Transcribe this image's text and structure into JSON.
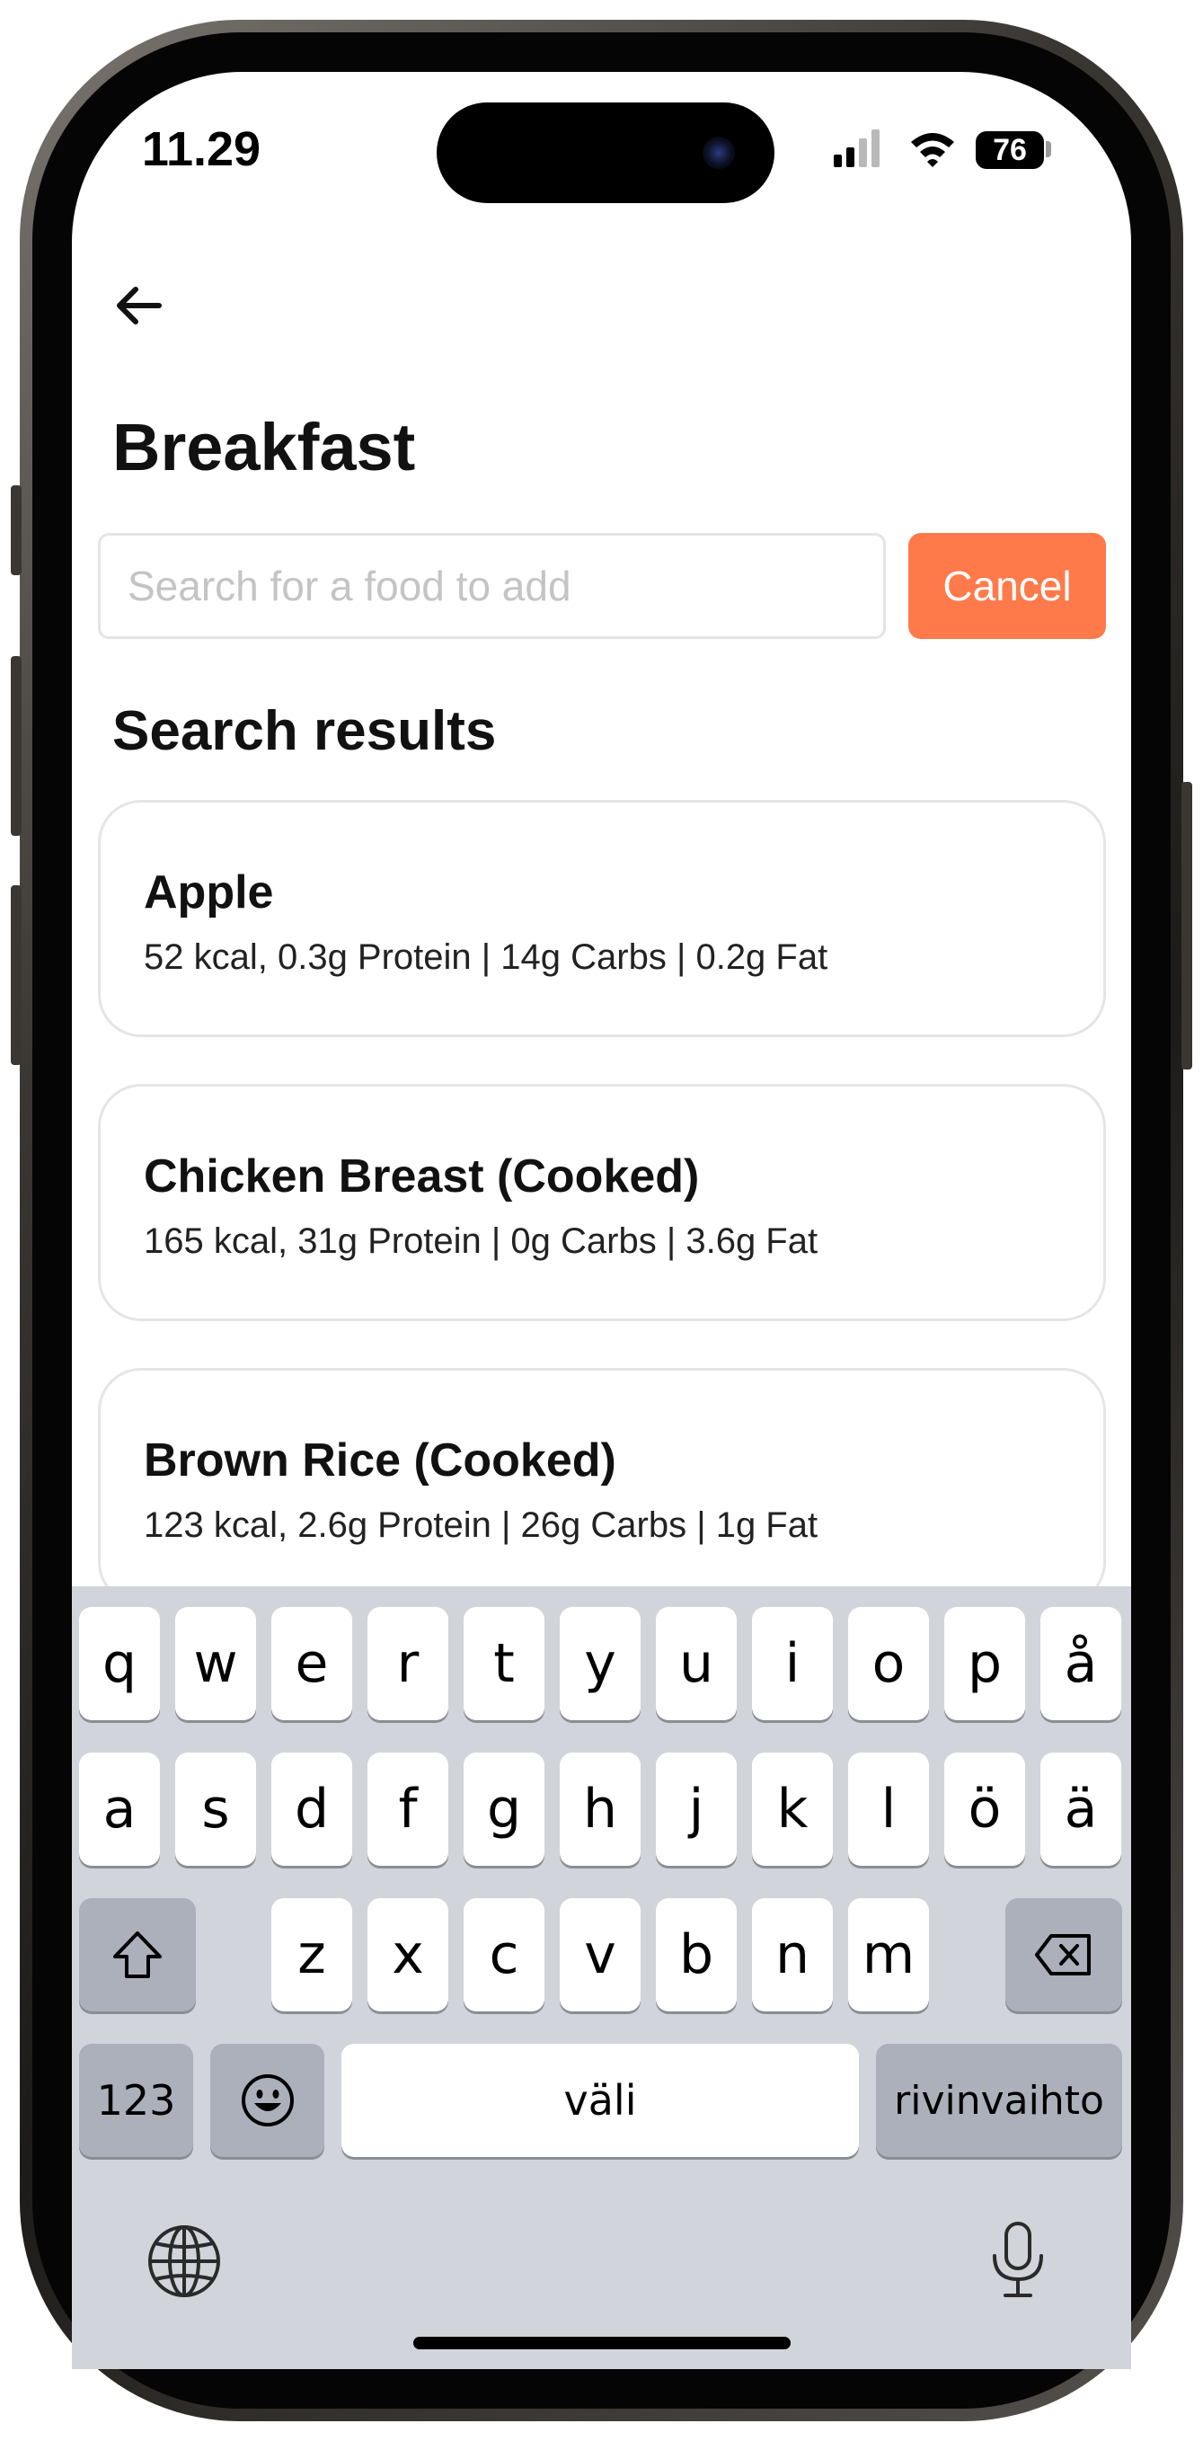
{
  "status_bar": {
    "time": "11.29",
    "battery": "76"
  },
  "app": {
    "title": "Breakfast",
    "search": {
      "placeholder": "Search for a food to add",
      "value": ""
    },
    "cancel_label": "Cancel",
    "results_heading": "Search results",
    "results": [
      {
        "name": "Apple",
        "macros": "52 kcal, 0.3g Protein | 14g Carbs | 0.2g Fat"
      },
      {
        "name": "Chicken Breast (Cooked)",
        "macros": "165 kcal, 31g Protein | 0g Carbs | 3.6g Fat"
      },
      {
        "name": "Brown Rice (Cooked)",
        "macros": "123 kcal, 2.6g Protein | 26g Carbs | 1g Fat"
      }
    ]
  },
  "keyboard": {
    "row1": [
      "q",
      "w",
      "e",
      "r",
      "t",
      "y",
      "u",
      "i",
      "o",
      "p",
      "å"
    ],
    "row2": [
      "a",
      "s",
      "d",
      "f",
      "g",
      "h",
      "j",
      "k",
      "l",
      "ö",
      "ä"
    ],
    "row3": [
      "z",
      "x",
      "c",
      "v",
      "b",
      "n",
      "m"
    ],
    "numbers_label": "123",
    "space_label": "väli",
    "return_label": "rivinvaihto"
  },
  "colors": {
    "accent": "#ff7a4a",
    "keyboard_bg": "#d1d4db",
    "function_key": "#abb0ba"
  },
  "icons": [
    "back-arrow-icon",
    "cellular-signal-icon",
    "wifi-icon",
    "battery-icon",
    "shift-icon",
    "backspace-icon",
    "emoji-icon",
    "globe-icon",
    "microphone-icon"
  ]
}
